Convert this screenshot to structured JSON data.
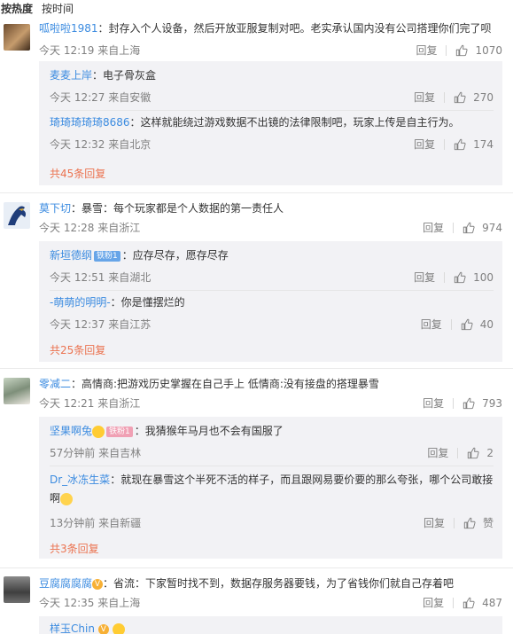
{
  "sort": {
    "hot": "按热度",
    "time": "按时间"
  },
  "common": {
    "reply": "回复",
    "like_word": "赞"
  },
  "comments": [
    {
      "user": "呱啦啦1981",
      "text": "：封存入个人设备，然后开放亚服复制对吧。老实承认国内没有公司搭理你们完了呗",
      "time": "今天 12:19",
      "location": "来自上海",
      "likes": "1070",
      "replies": [
        {
          "user": "麦麦上岸",
          "text": "：电子骨灰盒",
          "time": "今天 12:27",
          "location": "来自安徽",
          "likes": "270"
        },
        {
          "user": "琦琦琦琦琦8686",
          "text": "：这样就能绕过游戏数据不出镜的法律限制吧，玩家上传是自主行为。",
          "time": "今天 12:32",
          "location": "来自北京",
          "likes": "174"
        }
      ],
      "more": "共45条回复"
    },
    {
      "user": "莫下切",
      "text": "：暴雪：每个玩家都是个人数据的第一责任人",
      "time": "今天 12:28",
      "location": "来自浙江",
      "likes": "974",
      "replies": [
        {
          "user": "新垣德纲",
          "badge": "铁粉1",
          "text": "：应存尽存，愿存尽存",
          "time": "今天 12:51",
          "location": "来自湖北",
          "likes": "100"
        },
        {
          "user": "-萌萌的明明-",
          "text": "：你是懂摆烂的",
          "time": "今天 12:37",
          "location": "来自江苏",
          "likes": "40"
        }
      ],
      "more": "共25条回复"
    },
    {
      "user": "零减二",
      "text": "：高情商:把游戏历史掌握在自己手上 低情商:没有接盘的搭理暴雪",
      "time": "今天 12:21",
      "location": "来自浙江",
      "likes": "793",
      "replies": [
        {
          "user": "坚果啊兔",
          "badge": "铁粉1",
          "text": "：我猜猴年马月也不会有国服了",
          "time": "57分钟前",
          "location": "来自吉林",
          "likes": "2"
        },
        {
          "user": "Dr_冰冻生菜",
          "text": "：就现在暴雪这个半死不活的样子，而且跟网易要价要的那么夸张，哪个公司敢接啊",
          "time": "13分钟前",
          "location": "来自新疆",
          "likes": "赞"
        }
      ],
      "more": "共3条回复"
    },
    {
      "user": "豆腐腐腐腐",
      "text": "：省流：下家暂时找不到，数据存服务器要钱，为了省钱你们就自己存着吧",
      "time": "今天 12:35",
      "location": "来自上海",
      "likes": "487",
      "replies": [
        {
          "user": "样玉Chin"
        }
      ]
    }
  ],
  "colors": {
    "link": "#3b8be0",
    "more": "#eb7350",
    "reply_bg": "#f2f2f5"
  }
}
